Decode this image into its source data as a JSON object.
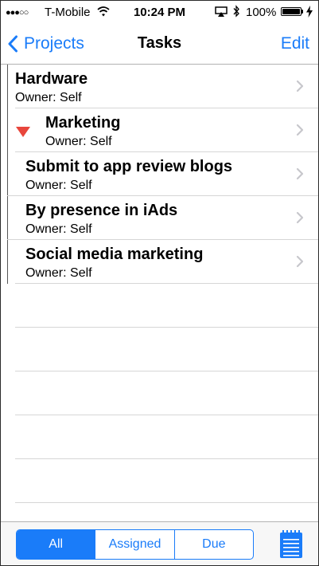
{
  "status_bar": {
    "signal": "●●●○○",
    "carrier": "T-Mobile",
    "wifi_icon": "wifi-icon",
    "time": "10:24 PM",
    "airplay_icon": "airplay-icon",
    "bluetooth_icon": "bluetooth-icon",
    "battery_percent": "100%",
    "battery_level": 1.0,
    "charging_icon": "charging-bolt-icon"
  },
  "nav": {
    "back_label": "Projects",
    "title": "Tasks",
    "edit_label": "Edit"
  },
  "tasks": [
    {
      "title": "Hardware",
      "owner": "Owner: Self",
      "expanded": false
    },
    {
      "title": "Marketing",
      "owner": "Owner: Self",
      "expanded": true
    },
    {
      "title": "Submit to app review blogs",
      "owner": "Owner: Self"
    },
    {
      "title": "By presence in iAds",
      "owner": "Owner: Self"
    },
    {
      "title": "Social media marketing",
      "owner": "Owner: Self"
    }
  ],
  "toolbar": {
    "segments": [
      {
        "label": "All",
        "selected": true
      },
      {
        "label": "Assigned",
        "selected": false
      },
      {
        "label": "Due",
        "selected": false
      }
    ],
    "notes_icon": "notepad-icon"
  },
  "colors": {
    "accent": "#1a7cf9",
    "expand_triangle": "#e8463c"
  }
}
